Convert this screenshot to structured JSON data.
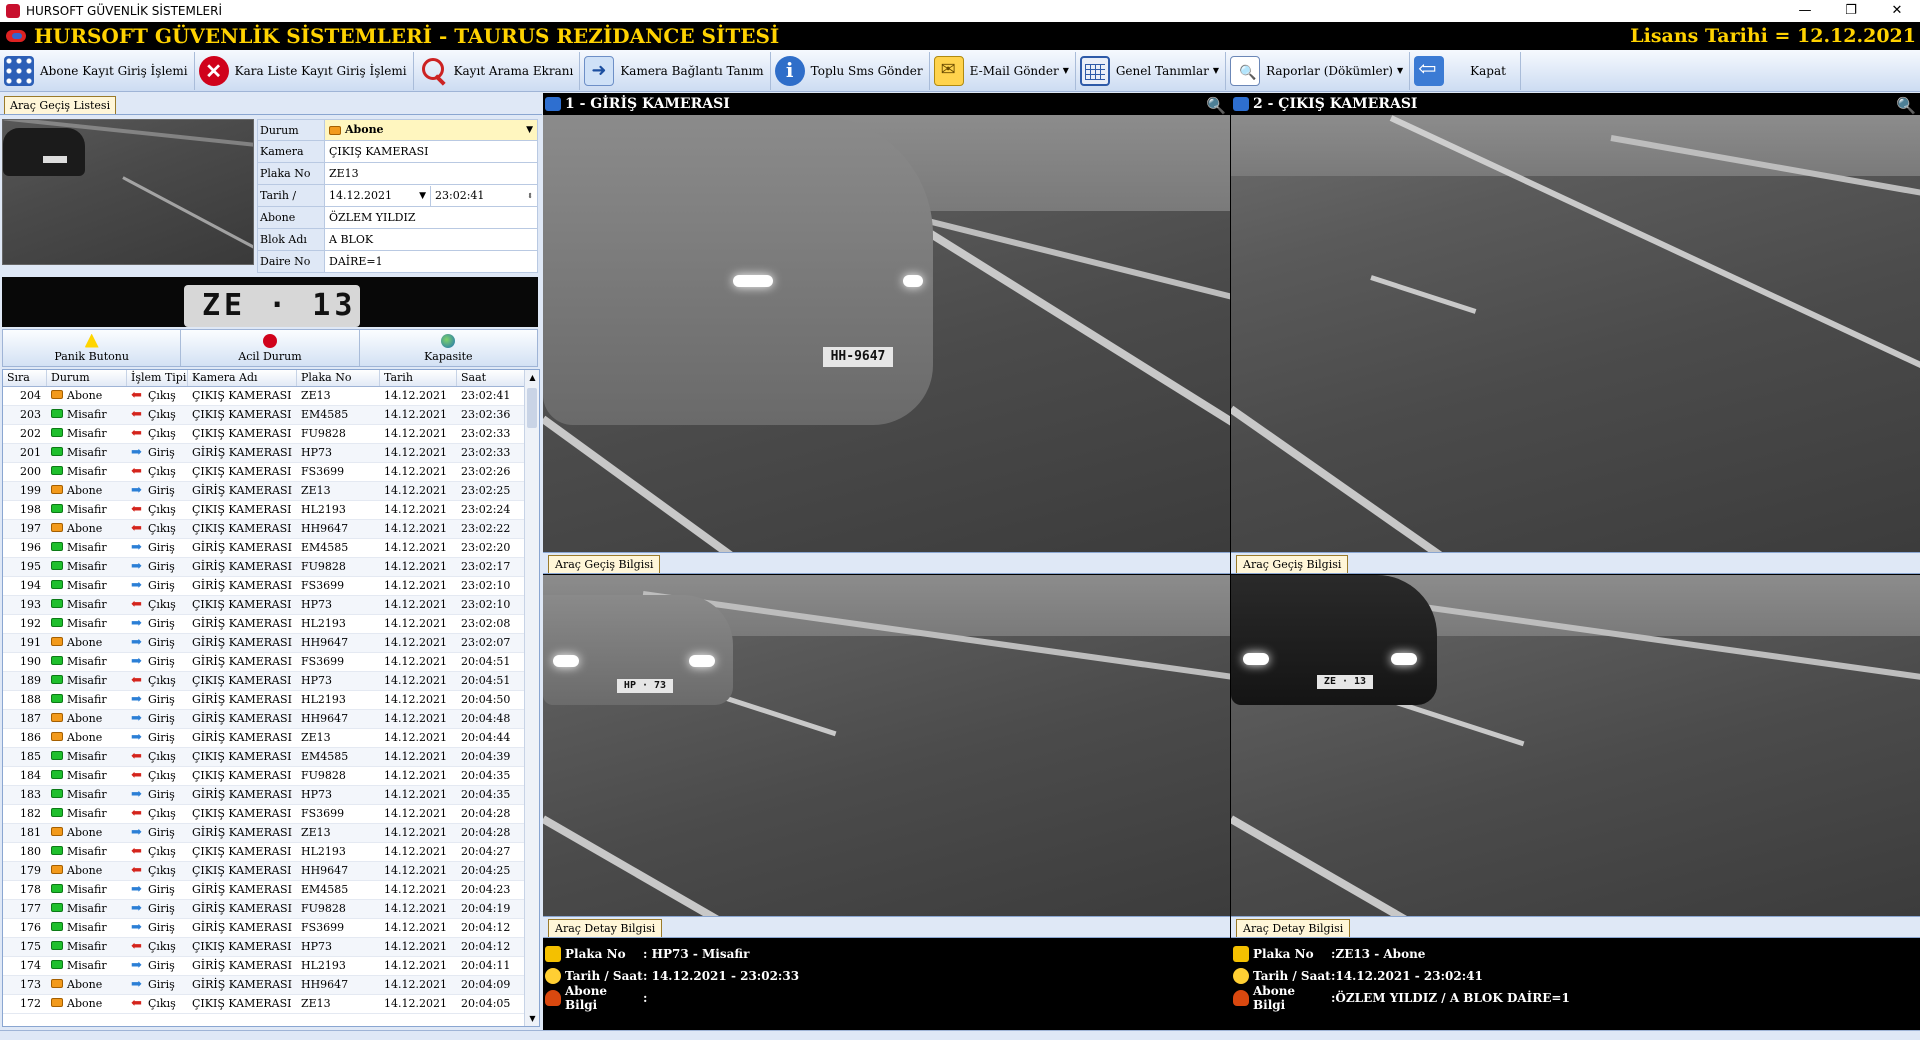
{
  "window": {
    "title": "HURSOFT GÜVENLİK SİSTEMLERİ",
    "min": "—",
    "max": "❐",
    "close": "✕"
  },
  "header": {
    "title": "HURSOFT GÜVENLİK SİSTEMLERİ - TAURUS REZİDANCE SİTESİ",
    "license": "Lisans Tarihi = 12.12.2021"
  },
  "toolbar": [
    {
      "name": "abone-kayit-button",
      "icon": "grid",
      "label": "Abone Kayıt Giriş İşlemi",
      "dropdown": false
    },
    {
      "name": "kara-liste-button",
      "icon": "xred",
      "label": "Kara Liste Kayıt Giriş İşlemi",
      "dropdown": false
    },
    {
      "name": "kayit-arama-button",
      "icon": "search",
      "label": "Kayıt Arama Ekranı",
      "dropdown": false
    },
    {
      "name": "kamera-baglanti-button",
      "icon": "cam",
      "label": "Kamera Bağlantı Tanım",
      "dropdown": false
    },
    {
      "name": "toplu-sms-button",
      "icon": "sms",
      "label": "Toplu Sms Gönder",
      "dropdown": false
    },
    {
      "name": "email-gonder-button",
      "icon": "mail",
      "label": "E-Mail Gönder",
      "dropdown": true
    },
    {
      "name": "genel-tanimlar-button",
      "icon": "cal",
      "label": "Genel Tanımlar",
      "dropdown": true
    },
    {
      "name": "raporlar-button",
      "icon": "rep",
      "label": "Raporlar (Dökümler)",
      "dropdown": true
    },
    {
      "name": "kapat-button",
      "icon": "exit",
      "label": "Kapat",
      "dropdown": false
    }
  ],
  "left": {
    "tab": "Araç Geçiş Listesi",
    "form": {
      "durum_label": "Durum",
      "durum_value": "Abone",
      "kamera_label": "Kamera Adı",
      "kamera_value": "ÇIKIŞ KAMERASI",
      "plaka_label": "Plaka No",
      "plaka_value": "ZE13",
      "tarih_label": "Tarih / Saat",
      "tarih_value": "14.12.2021",
      "saat_value": "23:02:41",
      "abone_label": "Abone Bilgi",
      "abone_value": "ÖZLEM YILDIZ",
      "blok_label": "Blok Adı",
      "blok_value": "A BLOK",
      "daire_label": "Daire No",
      "daire_value": "DAİRE=1"
    },
    "plate_crop": "ZE · 13",
    "buttons": {
      "panik": "Panik Butonu",
      "acil": "Acil Durum",
      "kapasite": "Kapasite"
    },
    "grid": {
      "headers": [
        "Sıra",
        "Durum",
        "İşlem Tipi",
        "Kamera Adı",
        "Plaka No",
        "Tarih",
        "Saat"
      ],
      "rows": [
        [
          "204",
          "Abone",
          "Çıkış",
          "ÇIKIŞ KAMERASI",
          "ZE13",
          "14.12.2021",
          "23:02:41"
        ],
        [
          "203",
          "Misafir",
          "Çıkış",
          "ÇIKIŞ KAMERASI",
          "EM4585",
          "14.12.2021",
          "23:02:36"
        ],
        [
          "202",
          "Misafir",
          "Çıkış",
          "ÇIKIŞ KAMERASI",
          "FU9828",
          "14.12.2021",
          "23:02:33"
        ],
        [
          "201",
          "Misafir",
          "Giriş",
          "GİRİŞ KAMERASI",
          "HP73",
          "14.12.2021",
          "23:02:33"
        ],
        [
          "200",
          "Misafir",
          "Çıkış",
          "ÇIKIŞ KAMERASI",
          "FS3699",
          "14.12.2021",
          "23:02:26"
        ],
        [
          "199",
          "Abone",
          "Giriş",
          "GİRİŞ KAMERASI",
          "ZE13",
          "14.12.2021",
          "23:02:25"
        ],
        [
          "198",
          "Misafir",
          "Çıkış",
          "ÇIKIŞ KAMERASI",
          "HL2193",
          "14.12.2021",
          "23:02:24"
        ],
        [
          "197",
          "Abone",
          "Çıkış",
          "ÇIKIŞ KAMERASI",
          "HH9647",
          "14.12.2021",
          "23:02:22"
        ],
        [
          "196",
          "Misafir",
          "Giriş",
          "GİRİŞ KAMERASI",
          "EM4585",
          "14.12.2021",
          "23:02:20"
        ],
        [
          "195",
          "Misafir",
          "Giriş",
          "GİRİŞ KAMERASI",
          "FU9828",
          "14.12.2021",
          "23:02:17"
        ],
        [
          "194",
          "Misafir",
          "Giriş",
          "GİRİŞ KAMERASI",
          "FS3699",
          "14.12.2021",
          "23:02:10"
        ],
        [
          "193",
          "Misafir",
          "Çıkış",
          "ÇIKIŞ KAMERASI",
          "HP73",
          "14.12.2021",
          "23:02:10"
        ],
        [
          "192",
          "Misafir",
          "Giriş",
          "GİRİŞ KAMERASI",
          "HL2193",
          "14.12.2021",
          "23:02:08"
        ],
        [
          "191",
          "Abone",
          "Giriş",
          "GİRİŞ KAMERASI",
          "HH9647",
          "14.12.2021",
          "23:02:07"
        ],
        [
          "190",
          "Misafir",
          "Giriş",
          "GİRİŞ KAMERASI",
          "FS3699",
          "14.12.2021",
          "20:04:51"
        ],
        [
          "189",
          "Misafir",
          "Çıkış",
          "ÇIKIŞ KAMERASI",
          "HP73",
          "14.12.2021",
          "20:04:51"
        ],
        [
          "188",
          "Misafir",
          "Giriş",
          "GİRİŞ KAMERASI",
          "HL2193",
          "14.12.2021",
          "20:04:50"
        ],
        [
          "187",
          "Abone",
          "Giriş",
          "GİRİŞ KAMERASI",
          "HH9647",
          "14.12.2021",
          "20:04:48"
        ],
        [
          "186",
          "Abone",
          "Giriş",
          "GİRİŞ KAMERASI",
          "ZE13",
          "14.12.2021",
          "20:04:44"
        ],
        [
          "185",
          "Misafir",
          "Çıkış",
          "ÇIKIŞ KAMERASI",
          "EM4585",
          "14.12.2021",
          "20:04:39"
        ],
        [
          "184",
          "Misafir",
          "Çıkış",
          "ÇIKIŞ KAMERASI",
          "FU9828",
          "14.12.2021",
          "20:04:35"
        ],
        [
          "183",
          "Misafir",
          "Giriş",
          "GİRİŞ KAMERASI",
          "HP73",
          "14.12.2021",
          "20:04:35"
        ],
        [
          "182",
          "Misafir",
          "Çıkış",
          "ÇIKIŞ KAMERASI",
          "FS3699",
          "14.12.2021",
          "20:04:28"
        ],
        [
          "181",
          "Abone",
          "Giriş",
          "GİRİŞ KAMERASI",
          "ZE13",
          "14.12.2021",
          "20:04:28"
        ],
        [
          "180",
          "Misafir",
          "Çıkış",
          "ÇIKIŞ KAMERASI",
          "HL2193",
          "14.12.2021",
          "20:04:27"
        ],
        [
          "179",
          "Abone",
          "Çıkış",
          "ÇIKIŞ KAMERASI",
          "HH9647",
          "14.12.2021",
          "20:04:25"
        ],
        [
          "178",
          "Misafir",
          "Giriş",
          "GİRİŞ KAMERASI",
          "EM4585",
          "14.12.2021",
          "20:04:23"
        ],
        [
          "177",
          "Misafir",
          "Giriş",
          "GİRİŞ KAMERASI",
          "FU9828",
          "14.12.2021",
          "20:04:19"
        ],
        [
          "176",
          "Misafir",
          "Giriş",
          "GİRİŞ KAMERASI",
          "FS3699",
          "14.12.2021",
          "20:04:12"
        ],
        [
          "175",
          "Misafir",
          "Çıkış",
          "ÇIKIŞ KAMERASI",
          "HP73",
          "14.12.2021",
          "20:04:12"
        ],
        [
          "174",
          "Misafir",
          "Giriş",
          "GİRİŞ KAMERASI",
          "HL2193",
          "14.12.2021",
          "20:04:11"
        ],
        [
          "173",
          "Abone",
          "Giriş",
          "GİRİŞ KAMERASI",
          "HH9647",
          "14.12.2021",
          "20:04:09"
        ],
        [
          "172",
          "Abone",
          "Çıkış",
          "ÇIKIŞ KAMERASI",
          "ZE13",
          "14.12.2021",
          "20:04:05"
        ]
      ]
    }
  },
  "cameras": {
    "cam1_title": "1 - GİRİŞ KAMERASI",
    "cam2_title": "2 - ÇIKIŞ KAMERASI",
    "plate_cam1": "HH-9647",
    "plate_bottom1": "HP · 73",
    "plate_bottom2": "ZE · 13",
    "info_tab": "Araç Geçiş Bilgisi",
    "detail_tab": "Araç Detay Bilgisi"
  },
  "detail1": {
    "plaka_label": "Plaka No",
    "plaka_value": ": HP73 - Misafir",
    "tarih_label": "Tarih / Saat",
    "tarih_value": ": 14.12.2021 - 23:02:33",
    "abone_label": "Abone Bilgi",
    "abone_value": ":"
  },
  "detail2": {
    "plaka_label": "Plaka No",
    "plaka_value": ":ZE13 - Abone",
    "tarih_label": "Tarih / Saat",
    "tarih_value": ":14.12.2021 - 23:02:41",
    "abone_label": "Abone Bilgi",
    "abone_value": ":ÖZLEM YILDIZ / A BLOK DAİRE=1"
  },
  "colors": {
    "abone": "#f29a1c",
    "misafir": "#1fbf2d",
    "cikis_arrow": "#d4241c",
    "giris_arrow": "#2b7fd6",
    "header_text": "#ffd200"
  }
}
